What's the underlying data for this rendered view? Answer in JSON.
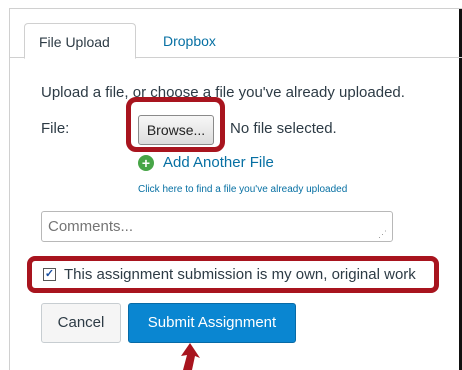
{
  "tabs": [
    {
      "label": "File Upload",
      "active": true
    },
    {
      "label": "Dropbox",
      "active": false
    }
  ],
  "upload": {
    "instructions": "Upload a file, or choose a file you've already uploaded.",
    "file_label": "File:",
    "browse_label": "Browse...",
    "no_file_text": "No file selected.",
    "add_another_label": "Add Another File",
    "find_uploaded_link": "Click here to find a file you've already uploaded"
  },
  "comments": {
    "placeholder": "Comments...",
    "value": ""
  },
  "agreement": {
    "label": "This assignment submission is my own, original work",
    "checked": true
  },
  "actions": {
    "cancel_label": "Cancel",
    "submit_label": "Submit Assignment"
  },
  "colors": {
    "highlight": "#a8141e",
    "link": "#0770a3",
    "primary": "#0a86d1",
    "add_icon": "#47a547"
  },
  "icons": [
    "add-icon",
    "checkbox-icon",
    "resize-grip-icon",
    "pointer-arrow-icon"
  ]
}
